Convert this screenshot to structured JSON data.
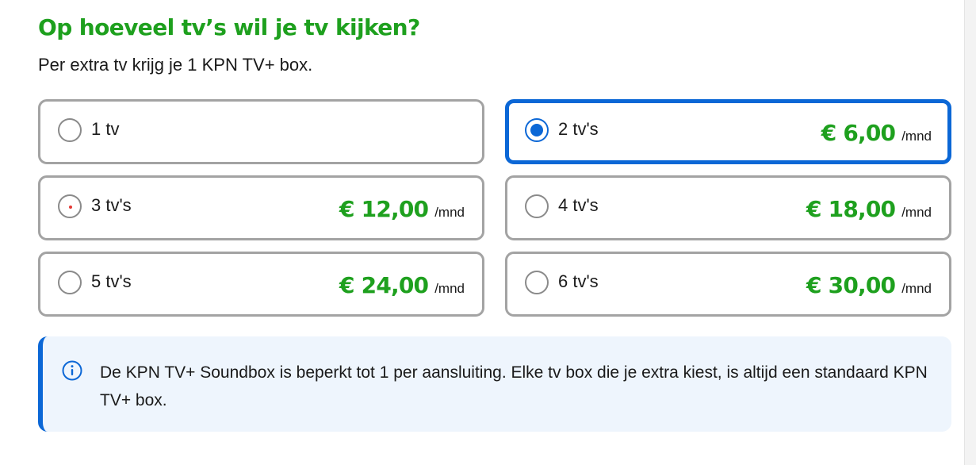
{
  "heading": "Op hoeveel tv’s wil je tv kijken?",
  "subtitle": "Per extra tv krijg je 1 KPN TV+ box.",
  "colors": {
    "accent_green": "#1ea01e",
    "selected_blue": "#0b67d6",
    "info_background": "#eef5fd"
  },
  "options": [
    {
      "label": "1 tv",
      "price": "",
      "unit": "",
      "selected": false
    },
    {
      "label": "2 tv's",
      "price": "€ 6,00",
      "unit": "/mnd",
      "selected": true
    },
    {
      "label": "3 tv's",
      "price": "€ 12,00",
      "unit": "/mnd",
      "selected": false
    },
    {
      "label": "4 tv's",
      "price": "€ 18,00",
      "unit": "/mnd",
      "selected": false
    },
    {
      "label": "5 tv's",
      "price": "€ 24,00",
      "unit": "/mnd",
      "selected": false
    },
    {
      "label": "6 tv's",
      "price": "€ 30,00",
      "unit": "/mnd",
      "selected": false
    }
  ],
  "info": {
    "icon": "info-icon",
    "text": "De KPN TV+ Soundbox is beperkt tot 1 per aansluiting. Elke tv box die je extra kiest, is altijd een standaard KPN TV+ box."
  }
}
